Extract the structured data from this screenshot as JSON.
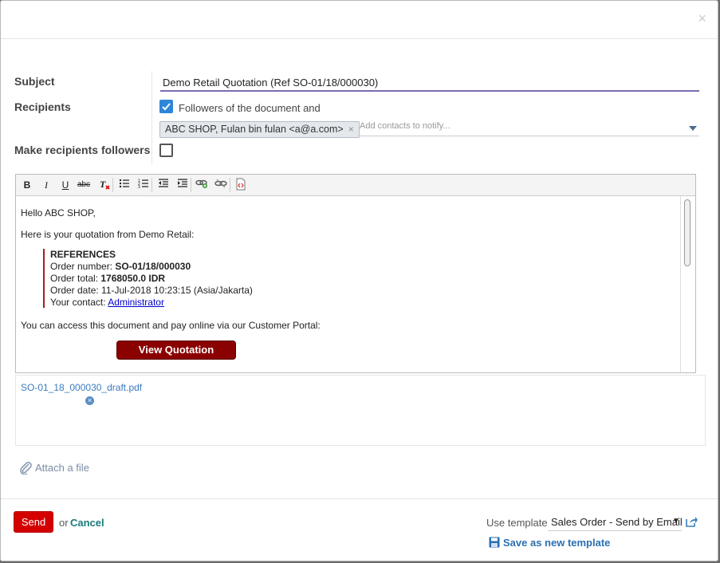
{
  "dialog": {
    "close_symbol": "×"
  },
  "form": {
    "subject_label": "Subject",
    "subject_value": "Demo Retail Quotation (Ref SO-01/18/000030)",
    "recipients_label": "Recipients",
    "followers_checked": true,
    "followers_text": "Followers of the document and",
    "recipient_tag": "ABC SHOP, Fulan bin fulan <a@a.com>",
    "recipient_tag_remove": "×",
    "contacts_placeholder": "Add contacts to notify...",
    "make_followers_label": "Make recipients followers",
    "make_followers_checked": false
  },
  "toolbar": {
    "bold": "B",
    "italic": "I",
    "underline": "U",
    "strikethrough": "abc"
  },
  "body": {
    "greeting": "Hello ABC SHOP,",
    "intro": "Here is your quotation from Demo Retail:",
    "references_title": "REFERENCES",
    "order_number_label": "Order number: ",
    "order_number": "SO-01/18/000030",
    "order_total_label": "Order total: ",
    "order_total": "1768050.0 IDR",
    "order_date_label": "Order date: ",
    "order_date": "11-Jul-2018 10:23:15 (Asia/Jakarta)",
    "contact_label": "Your contact: ",
    "contact_name": "Administrator",
    "portal_text": "You can access this document and pay online via our Customer Portal:",
    "view_button": "View Quotation"
  },
  "attachments": {
    "file_name": "SO-01_18_000030_draft.pdf",
    "remove_symbol": "×",
    "attach_label": "Attach a file"
  },
  "footer": {
    "send_label": "Send",
    "or_text": "or",
    "cancel_label": "Cancel",
    "use_template_label": "Use template",
    "template_value": "Sales Order - Send by Email",
    "save_template_label": "Save as new template"
  },
  "colors": {
    "send_button": "#d40000",
    "view_button": "#8b0000",
    "checkbox": "#2f86d9",
    "subject_underline": "#7c6bb0"
  }
}
